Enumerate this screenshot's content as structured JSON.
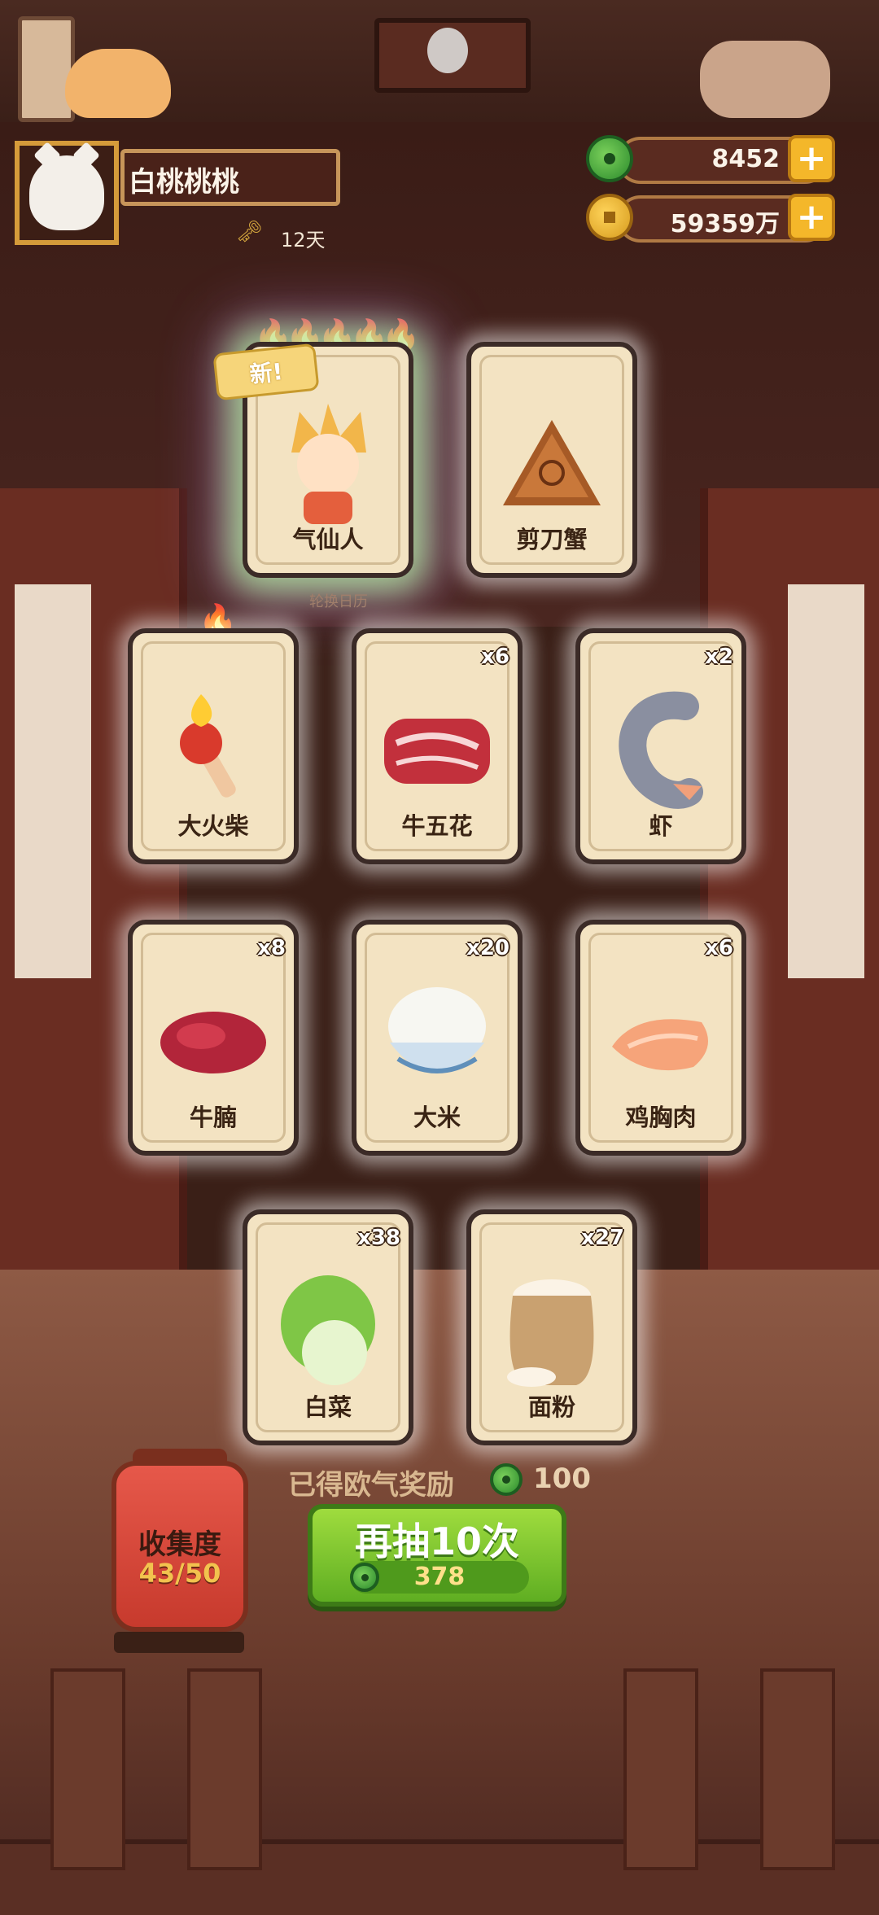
{
  "profile": {
    "name": "白桃桃桃",
    "days": "12天"
  },
  "currencies": {
    "jade": "8452",
    "coins": "59359万"
  },
  "cards": [
    {
      "name": "气仙人",
      "qty": "",
      "badge": "新!"
    },
    {
      "name": "剪刀蟹",
      "qty": ""
    },
    {
      "name": "大火柴",
      "qty": ""
    },
    {
      "name": "牛五花",
      "qty": "x6"
    },
    {
      "name": "虾",
      "qty": "x2"
    },
    {
      "name": "牛腩",
      "qty": "x8"
    },
    {
      "name": "大米",
      "qty": "x20"
    },
    {
      "name": "鸡胸肉",
      "qty": "x6"
    },
    {
      "name": "白菜",
      "qty": "x38"
    },
    {
      "name": "面粉",
      "qty": "x27"
    }
  ],
  "hint": "轮换日历",
  "collection": {
    "label": "收集度",
    "count": "43/50"
  },
  "reward": {
    "label": "已得欧气奖励",
    "value": "100"
  },
  "draw": {
    "label": "再抽10次",
    "cost": "378"
  },
  "colors": {
    "card_bg": "#f3e3c2",
    "button_green": "#6fbe2a",
    "lantern_red": "#d84a3c",
    "currency_gold": "#f4b72a"
  }
}
